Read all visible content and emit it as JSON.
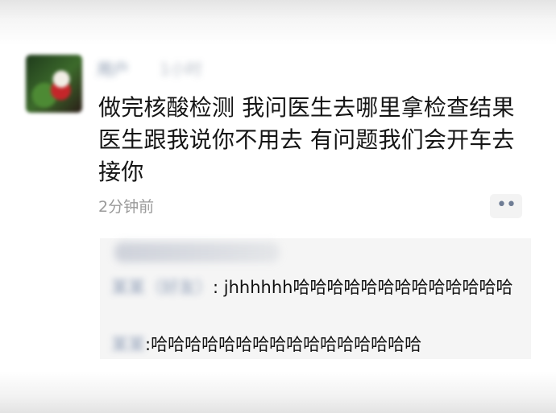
{
  "post": {
    "sender_name": "用户",
    "sender_meta": "1小时",
    "message_lines": [
      "做完核酸检测 我问医生去哪里拿检查结果",
      "医生跟我说你不用去 有问题我们会开车去",
      "接你"
    ],
    "timestamp": "2分钟前",
    "more_label": "••"
  },
  "comments": [
    {
      "author": "某某（好友）",
      "separator": ":",
      "text": "jhhhhhh哈哈哈哈哈哈哈哈哈哈哈哈哈"
    },
    {
      "author": "某某",
      "separator": ":",
      "text": "哈哈哈哈哈哈哈哈哈哈哈哈哈哈哈哈"
    }
  ]
}
